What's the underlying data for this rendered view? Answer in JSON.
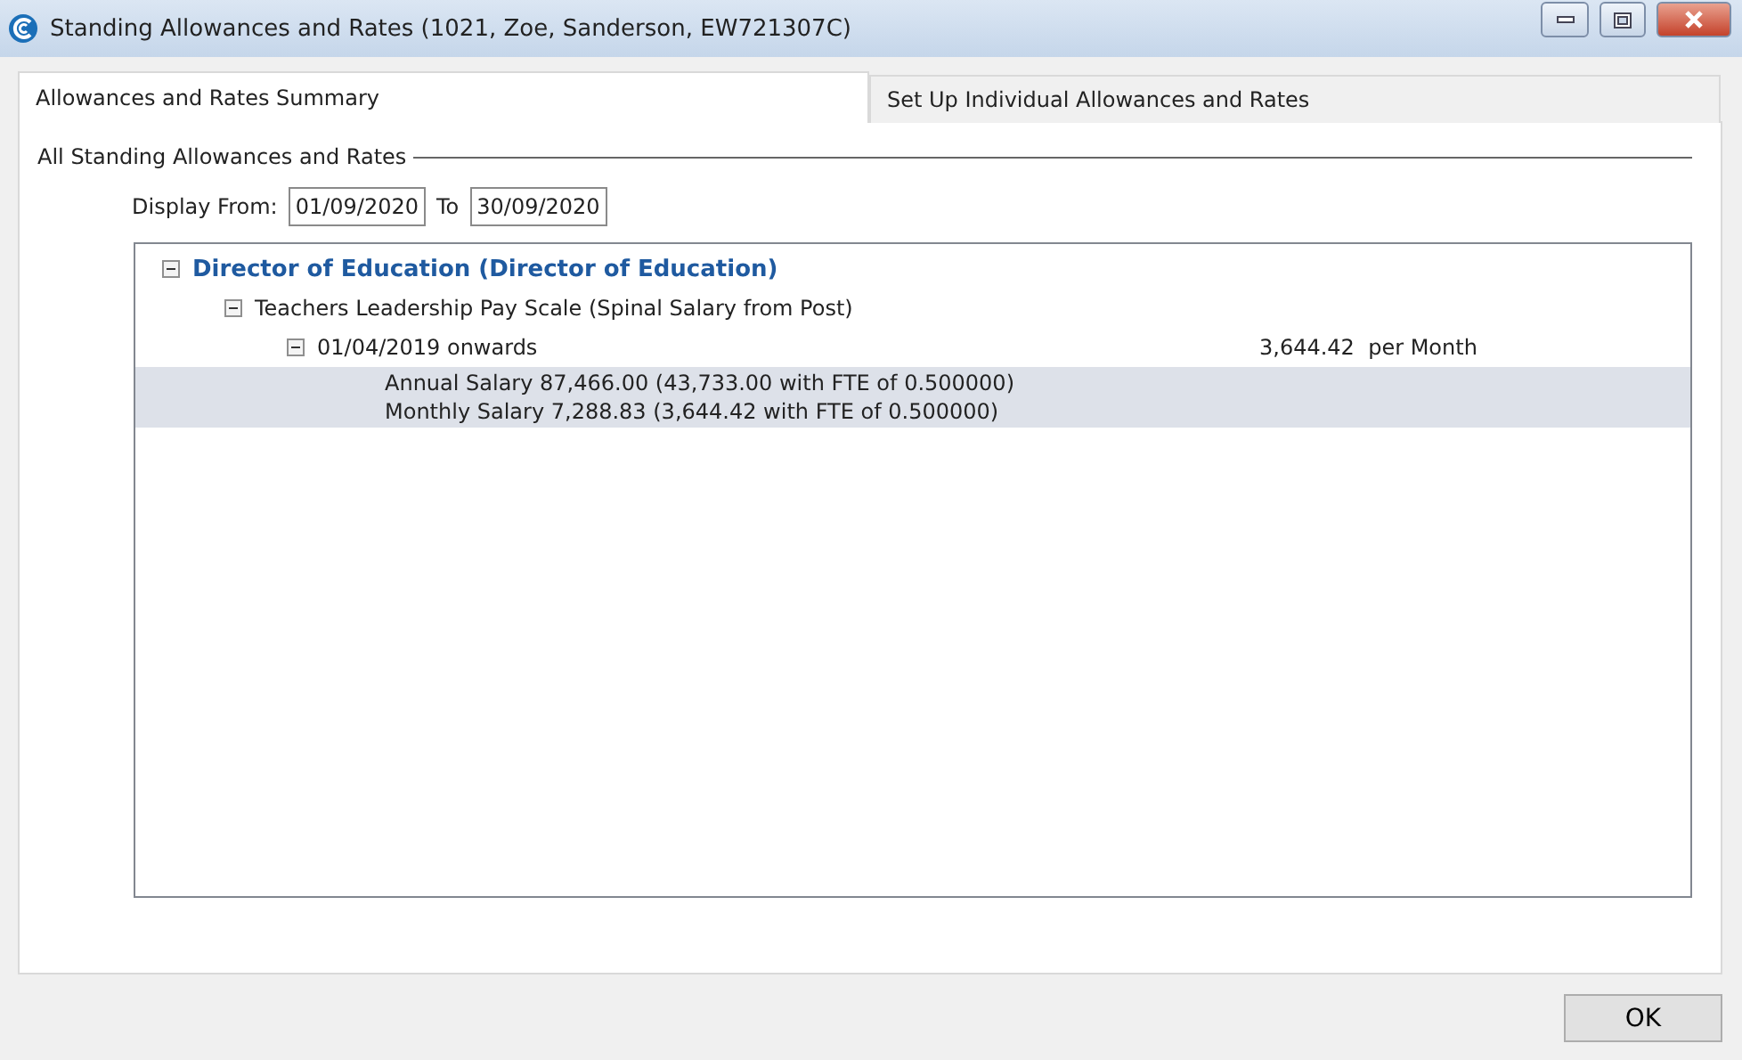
{
  "window": {
    "title": "Standing Allowances and Rates (1021, Zoe, Sanderson, EW721307C)"
  },
  "tabs": [
    {
      "label": "Allowances and Rates Summary",
      "selected": true
    },
    {
      "label": "Set Up Individual Allowances and Rates",
      "selected": false
    }
  ],
  "group": {
    "title": "All Standing Allowances and Rates",
    "display_from_label": "Display From:",
    "from": "01/09/2020",
    "to_label": "To",
    "to": "30/09/2020"
  },
  "tree": [
    {
      "label": "Director of Education (Director of Education)",
      "kind": "heading",
      "expanded": true,
      "selected": false,
      "children": [
        {
          "label": "Teachers Leadership Pay Scale (Spinal Salary from Post)",
          "kind": "item",
          "expanded": true,
          "selected": false,
          "children": [
            {
              "label": "01/04/2019 onwards",
              "kind": "item",
              "expanded": true,
              "selected": false,
              "amount": "3,644.42",
              "unit": "per Month",
              "children": [
                {
                  "kind": "detail",
                  "selected": true,
                  "lines": [
                    "Annual Salary 87,466.00 (43,733.00 with FTE of 0.500000)",
                    "Monthly Salary 7,288.83 (3,644.42 with FTE of 0.500000)"
                  ]
                }
              ]
            }
          ]
        }
      ]
    }
  ],
  "buttons": [
    {
      "label": "OK"
    }
  ]
}
